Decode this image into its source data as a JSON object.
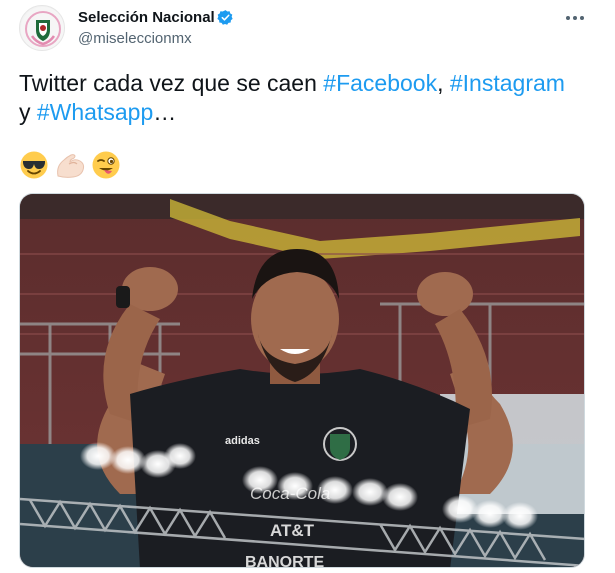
{
  "author": {
    "display_name": "Selección Nacional",
    "handle": "@miseleccionmx",
    "avatar_icon": "mexico-crest-pink-ribbon-icon",
    "verified_icon": "verified-badge-icon",
    "verified_color": "#1d9bf0"
  },
  "menu": {
    "more_icon": "more-options-icon"
  },
  "tweet": {
    "text_start": "Twitter cada vez que se caen ",
    "hashtags": [
      "#Facebook",
      "#Instagram",
      "#Whatsapp"
    ],
    "sep_comma": ", ",
    "sep_y": "y ",
    "ellipsis": "…",
    "emojis": [
      "smiling-face-with-sunglasses-icon",
      "flexed-biceps-icon",
      "winking-face-with-tongue-icon"
    ],
    "hashtag_color": "#1d9bf0"
  },
  "media": {
    "description_icon": "player-flexing-photo",
    "jersey_brand": "adidas",
    "sponsor_1": "Coca-Cola",
    "sponsor_2": "AT&T",
    "sponsor_3": "BANORTE"
  }
}
